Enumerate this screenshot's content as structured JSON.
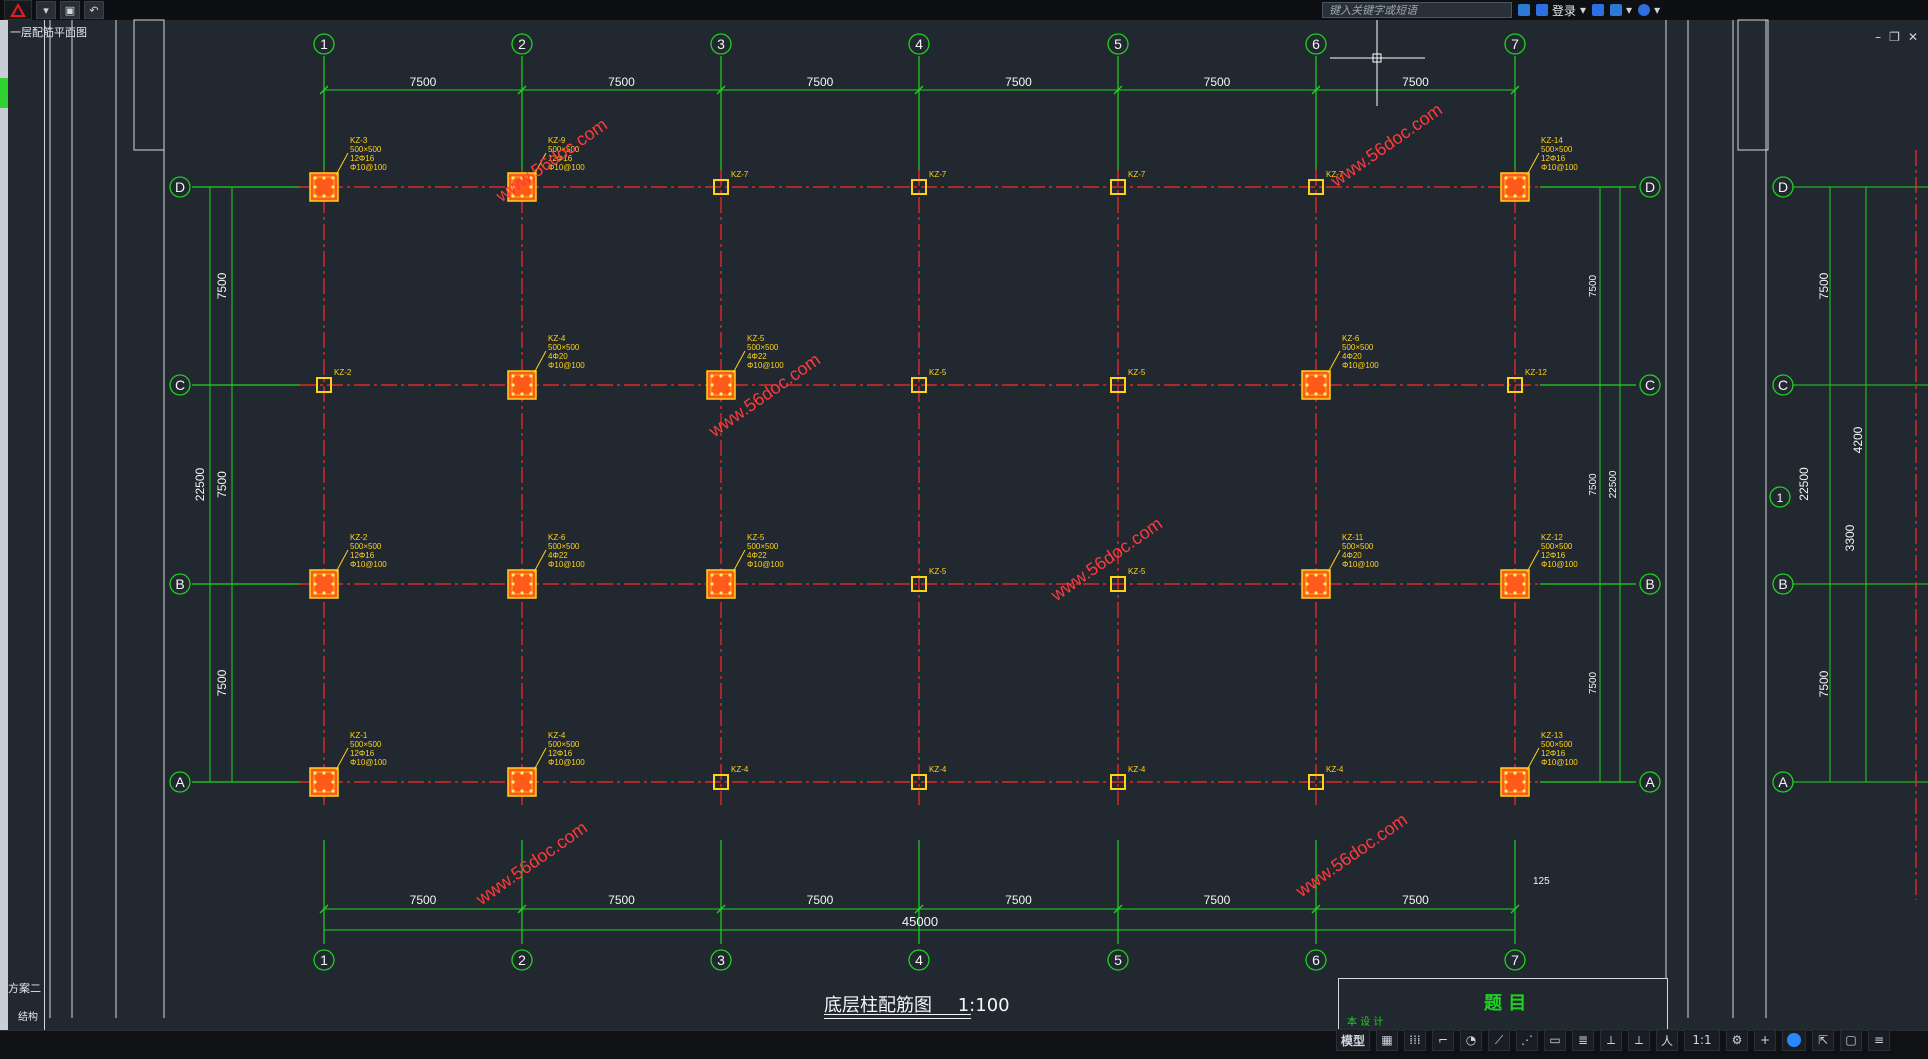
{
  "app": {
    "search_placeholder": "键入关键字或短语",
    "user_label": "登录",
    "left_top_label": "一层配筋平面图",
    "panel_note": "方案二",
    "panel_note2": "结构"
  },
  "drawing": {
    "grid_x": [
      "1",
      "2",
      "3",
      "4",
      "5",
      "6",
      "7"
    ],
    "grid_y": [
      "D",
      "C",
      "B",
      "A"
    ],
    "bay_spacing": [
      "7500",
      "7500",
      "7500",
      "7500",
      "7500",
      "7500"
    ],
    "y_spacing_labels": [
      "7500",
      "7500",
      "7500"
    ],
    "total_x": "45000",
    "total_y": "22500",
    "caption": "底层柱配筋图",
    "scale": "1:100",
    "side_dims": [
      "7500",
      "7500",
      "7500",
      "22500"
    ],
    "right_grid_labels": [
      "D",
      "C",
      "B",
      "A"
    ],
    "right_dims": [
      "7500",
      "4200",
      "3300",
      "7500"
    ],
    "right_total": "22500",
    "right_bay_note": "1",
    "offset_note": "125",
    "columns": {
      "rowD": [
        {
          "col": "1",
          "label": "KZ-3\n500×500\n12Φ16\nΦ10@100",
          "big": true
        },
        {
          "col": "2",
          "label": "KZ-9\n500×500\n12Φ16\nΦ10@100",
          "big": true
        },
        {
          "col": "3",
          "label": "KZ-7",
          "big": false
        },
        {
          "col": "4",
          "label": "KZ-7",
          "big": false
        },
        {
          "col": "5",
          "label": "KZ-7",
          "big": false
        },
        {
          "col": "6",
          "label": "KZ-7",
          "big": false
        },
        {
          "col": "7",
          "label": "KZ-14\n500×500\n12Φ16\nΦ10@100",
          "big": true
        }
      ],
      "rowC": [
        {
          "col": "1",
          "label": "KZ-2",
          "big": false
        },
        {
          "col": "2",
          "label": "KZ-4\n500×500\n4Φ20\nΦ10@100",
          "big": true
        },
        {
          "col": "3",
          "label": "KZ-5\n500×500\n4Φ22\nΦ10@100",
          "big": true
        },
        {
          "col": "4",
          "label": "KZ-5",
          "big": false
        },
        {
          "col": "5",
          "label": "KZ-5",
          "big": false
        },
        {
          "col": "6",
          "label": "KZ-6\n500×500\n4Φ20\nΦ10@100",
          "big": true
        },
        {
          "col": "7",
          "label": "KZ-12",
          "big": false
        }
      ],
      "rowB": [
        {
          "col": "1",
          "label": "KZ-2\n500×500\n12Φ16\nΦ10@100",
          "big": true
        },
        {
          "col": "2",
          "label": "KZ-6\n500×500\n4Φ22\nΦ10@100",
          "big": true
        },
        {
          "col": "3",
          "label": "KZ-5\n500×500\n4Φ22\nΦ10@100",
          "big": true
        },
        {
          "col": "4",
          "label": "KZ-5",
          "big": false
        },
        {
          "col": "5",
          "label": "KZ-5",
          "big": false
        },
        {
          "col": "6",
          "label": "KZ-11\n500×500\n4Φ20\nΦ10@100",
          "big": true
        },
        {
          "col": "7",
          "label": "KZ-12\n500×500\n12Φ16\nΦ10@100",
          "big": true
        }
      ],
      "rowA": [
        {
          "col": "1",
          "label": "KZ-1\n500×500\n12Φ16\nΦ10@100",
          "big": true
        },
        {
          "col": "2",
          "label": "KZ-4\n500×500\n12Φ16\nΦ10@100",
          "big": true
        },
        {
          "col": "3",
          "label": "KZ-4",
          "big": false
        },
        {
          "col": "4",
          "label": "KZ-4",
          "big": false
        },
        {
          "col": "5",
          "label": "KZ-4",
          "big": false
        },
        {
          "col": "6",
          "label": "KZ-4",
          "big": false
        },
        {
          "col": "7",
          "label": "KZ-13\n500×500\n12Φ16\nΦ10@100",
          "big": true
        }
      ]
    },
    "watermarks": [
      "www.56doc.com",
      "www.56doc.com",
      "www.56doc.com",
      "www.56doc.com",
      "www.56doc.com",
      "www.56doc.com"
    ]
  },
  "title_block": {
    "title": "题 目",
    "subtitle": "本 设 计"
  },
  "statusbar": {
    "model_label": "模型",
    "scale_label": "1:1",
    "items": [
      "▦",
      "⁞⁞⁞",
      "⌐",
      "◔",
      "⟋",
      "⋰",
      "▭",
      "≣",
      "⟂",
      "⟂",
      "人",
      "⚙",
      "+",
      "⦿",
      "⇱",
      "▢",
      "≡"
    ]
  },
  "colors": {
    "bg": "#212830",
    "grid_green": "#1fd31f",
    "axis_red": "#ff2a2a",
    "column_yellow": "#ffd21a",
    "column_orange": "#ff5a1a",
    "text_white": "#f5f5f5"
  }
}
